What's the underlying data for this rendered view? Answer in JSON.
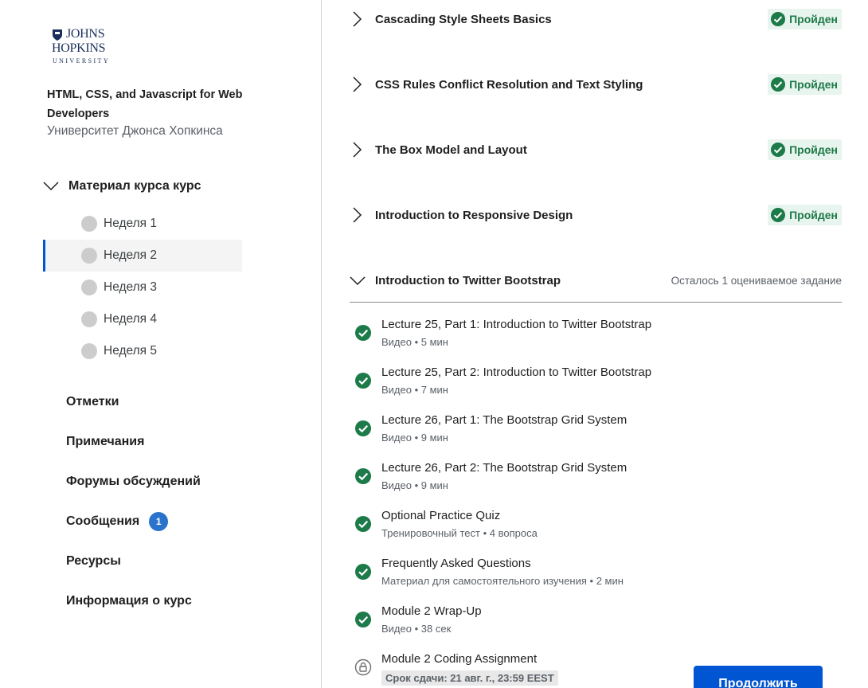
{
  "logo": {
    "line1": "JOHNS",
    "line2": "HOPKINS",
    "line3": "UNIVERSITY"
  },
  "course": {
    "title": "HTML, CSS, and Javascript for Web Developers",
    "org": "Университет Джонса Хопкинса"
  },
  "sidebar": {
    "material_label": "Материал курса курс",
    "weeks": [
      {
        "label": "Неделя 1"
      },
      {
        "label": "Неделя 2"
      },
      {
        "label": "Неделя 3"
      },
      {
        "label": "Неделя 4"
      },
      {
        "label": "Неделя 5"
      }
    ],
    "links": [
      {
        "label": "Отметки"
      },
      {
        "label": "Примечания"
      },
      {
        "label": "Форумы обсуждений"
      },
      {
        "label": "Сообщения",
        "badge": "1"
      },
      {
        "label": "Ресурсы"
      },
      {
        "label": "Информация о курс"
      }
    ]
  },
  "modules": [
    {
      "title": "Cascading Style Sheets Basics",
      "status": "Пройден"
    },
    {
      "title": "CSS Rules Conflict Resolution and Text Styling",
      "status": "Пройден"
    },
    {
      "title": "The Box Model and Layout",
      "status": "Пройден"
    },
    {
      "title": "Introduction to Responsive Design",
      "status": "Пройден"
    },
    {
      "title": "Introduction to Twitter Bootstrap",
      "remaining": "Осталось 1 оцениваемое задание"
    }
  ],
  "items": [
    {
      "name": "Lecture 25, Part 1: Introduction to Twitter Bootstrap",
      "type": "Видео",
      "detail": "5 мин"
    },
    {
      "name": "Lecture 25, Part 2: Introduction to Twitter Bootstrap",
      "type": "Видео",
      "detail": "7 мин"
    },
    {
      "name": "Lecture 26, Part 1: The Bootstrap Grid System",
      "type": "Видео",
      "detail": "9 мин"
    },
    {
      "name": "Lecture 26, Part 2: The Bootstrap Grid System",
      "type": "Видео",
      "detail": "9 мин"
    },
    {
      "name": "Optional Practice Quiz",
      "type": "Тренировочный тест",
      "detail": "4 вопроса"
    },
    {
      "name": "Frequently Asked Questions",
      "type": "Материал для самостоятельного изучения",
      "detail": "2 мин"
    },
    {
      "name": "Module 2 Wrap-Up",
      "type": "Видео",
      "detail": "38 сек"
    },
    {
      "name": "Module 2 Coding Assignment",
      "due": "Срок сдачи: 21 авг. г., 23:59 EEST"
    }
  ],
  "continue_label": "Продолжить",
  "colors": {
    "accent": "#0056d2",
    "success": "#1d7a49",
    "badge": "#2a73cc"
  }
}
